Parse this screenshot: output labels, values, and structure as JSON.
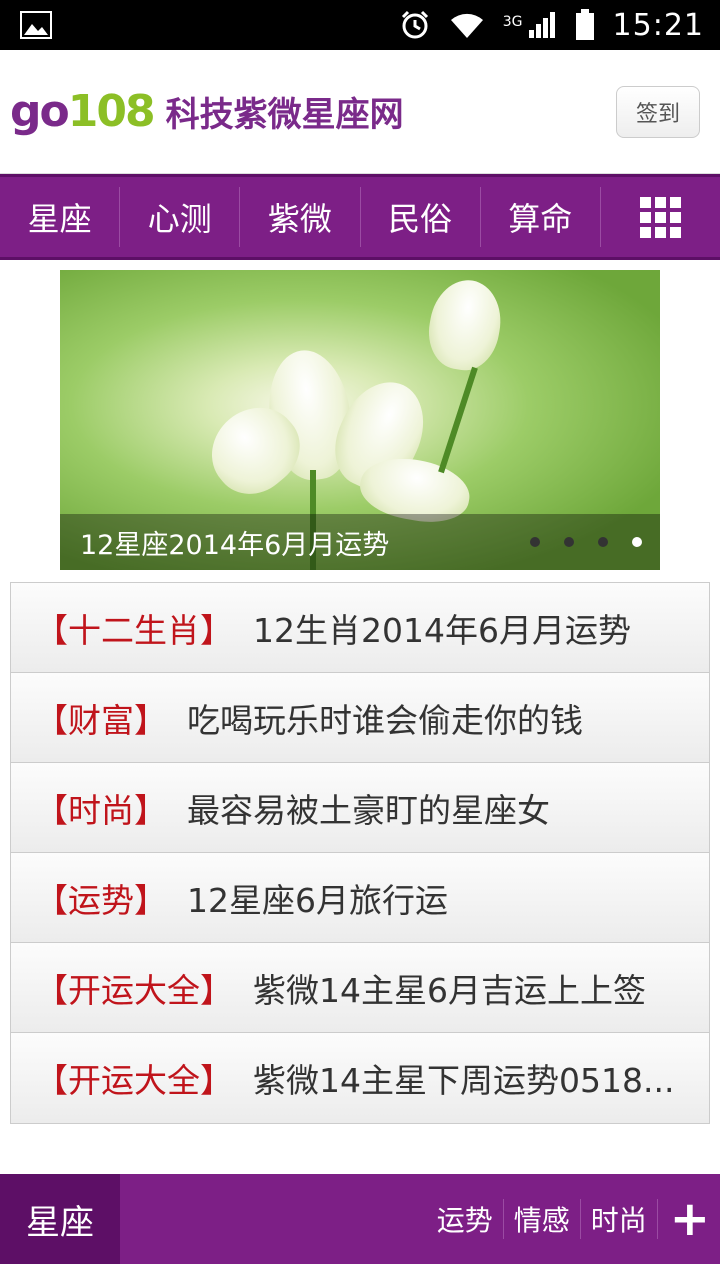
{
  "status_bar": {
    "time": "15:21",
    "network": "3G"
  },
  "header": {
    "logo_go": "go",
    "logo_num": "108",
    "logo_text": "科技紫微星座网",
    "signin_label": "签到"
  },
  "nav": {
    "items": [
      "星座",
      "心测",
      "紫微",
      "民俗",
      "算命"
    ],
    "more_icon": "grid-icon"
  },
  "banner": {
    "caption": "12星座2014年6月月运势",
    "slide_count": 4,
    "active_slide": 4
  },
  "list": [
    {
      "tag": "【十二生肖】",
      "title": "12生肖2014年6月月运势"
    },
    {
      "tag": "【财富】",
      "title": "吃喝玩乐时谁会偷走你的钱"
    },
    {
      "tag": "【时尚】",
      "title": "最容易被土豪盯的星座女"
    },
    {
      "tag": "【运势】",
      "title": "12星座6月旅行运"
    },
    {
      "tag": "【开运大全】",
      "title": "紫微14主星6月吉运上上签"
    },
    {
      "tag": "【开运大全】",
      "title": "紫微14主星下周运势0518..."
    }
  ],
  "section": {
    "title": "星座",
    "tabs": [
      "运势",
      "情感",
      "时尚"
    ],
    "more_label": "+"
  },
  "colors": {
    "primary": "#7d1f86",
    "dark": "#5d0f66",
    "tag": "#c0141b"
  }
}
